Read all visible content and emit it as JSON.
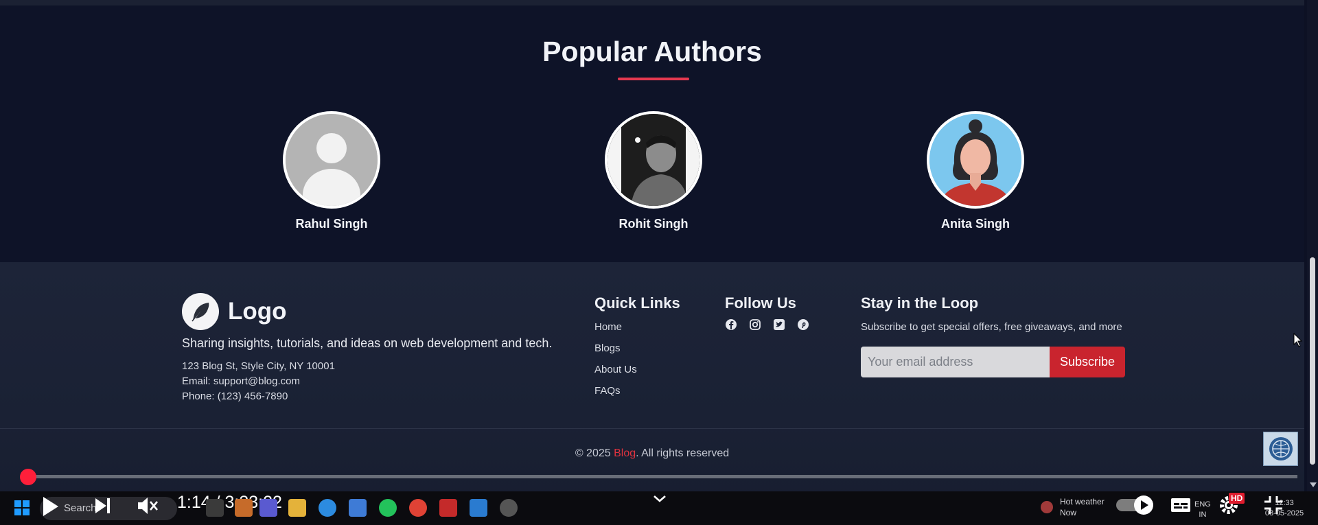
{
  "authors_section": {
    "title": "Popular Authors",
    "authors": [
      {
        "name": "Rahul Singh",
        "avatar": "default-user-avatar"
      },
      {
        "name": "Rohit Singh",
        "avatar": "photo-avatar"
      },
      {
        "name": "Anita Singh",
        "avatar": "illustrated-avatar"
      }
    ]
  },
  "footer": {
    "logo_text": "Logo",
    "tagline": "Sharing insights, tutorials, and ideas on web development and tech.",
    "address": "123 Blog St, Style City, NY 10001",
    "email": "Email: support@blog.com",
    "phone": "Phone: (123) 456-7890",
    "quick_links_title": "Quick Links",
    "quick_links": [
      "Home",
      "Blogs",
      "About Us",
      "FAQs"
    ],
    "follow_title": "Follow Us",
    "social_icons": [
      "facebook-icon",
      "instagram-icon",
      "twitter-icon",
      "pinterest-icon"
    ],
    "newsletter_title": "Stay in the Loop",
    "newsletter_sub": "Subscribe to get special offers, free giveaways, and more",
    "email_placeholder": "Your email address",
    "subscribe_label": "Subscribe",
    "copyright_prefix": "© 2025 ",
    "copyright_brand": "Blog",
    "copyright_suffix": ". All rights reserved"
  },
  "player": {
    "time": "1:14 / 3:33:22",
    "progress_fraction": 0.0
  },
  "taskbar": {
    "search_label": "Search",
    "weather_title": "Hot weather",
    "weather_sub": "Now",
    "lang_top": "ENG",
    "lang_bottom": "IN",
    "hd_label": "HD",
    "clock_time": "12:33",
    "clock_date": "08-05-2025"
  },
  "colors": {
    "accent": "#e63950",
    "button": "#c9242e",
    "progress": "#ff1f3a"
  }
}
